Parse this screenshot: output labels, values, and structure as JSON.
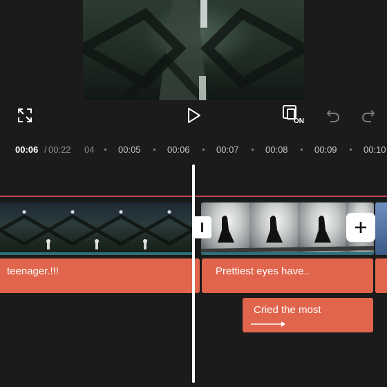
{
  "controls": {
    "fullscreen_icon": "fullscreen-icon",
    "play_icon": "play-icon",
    "preview_toggle_icon": "preview-toggle-icon",
    "preview_toggle_state": "ON",
    "undo_icon": "undo-icon",
    "redo_icon": "redo-icon"
  },
  "playback": {
    "current_time": "00:06",
    "separator": "/",
    "total_time": "00:22"
  },
  "ruler": {
    "ticks": [
      "04",
      "00:05",
      "00:06",
      "00:07",
      "00:08",
      "00:09",
      "00:10"
    ]
  },
  "tracks": {
    "split_label": "I",
    "add_clip_icon": "plus-icon",
    "texts": [
      "teenager.!!!",
      "Prettiest eyes have..",
      "",
      "Cried the most"
    ]
  },
  "colors": {
    "background": "#1b1b1b",
    "text_clip": "#e0654c",
    "track_marker": "#c2455a",
    "playhead": "#ffffff"
  }
}
